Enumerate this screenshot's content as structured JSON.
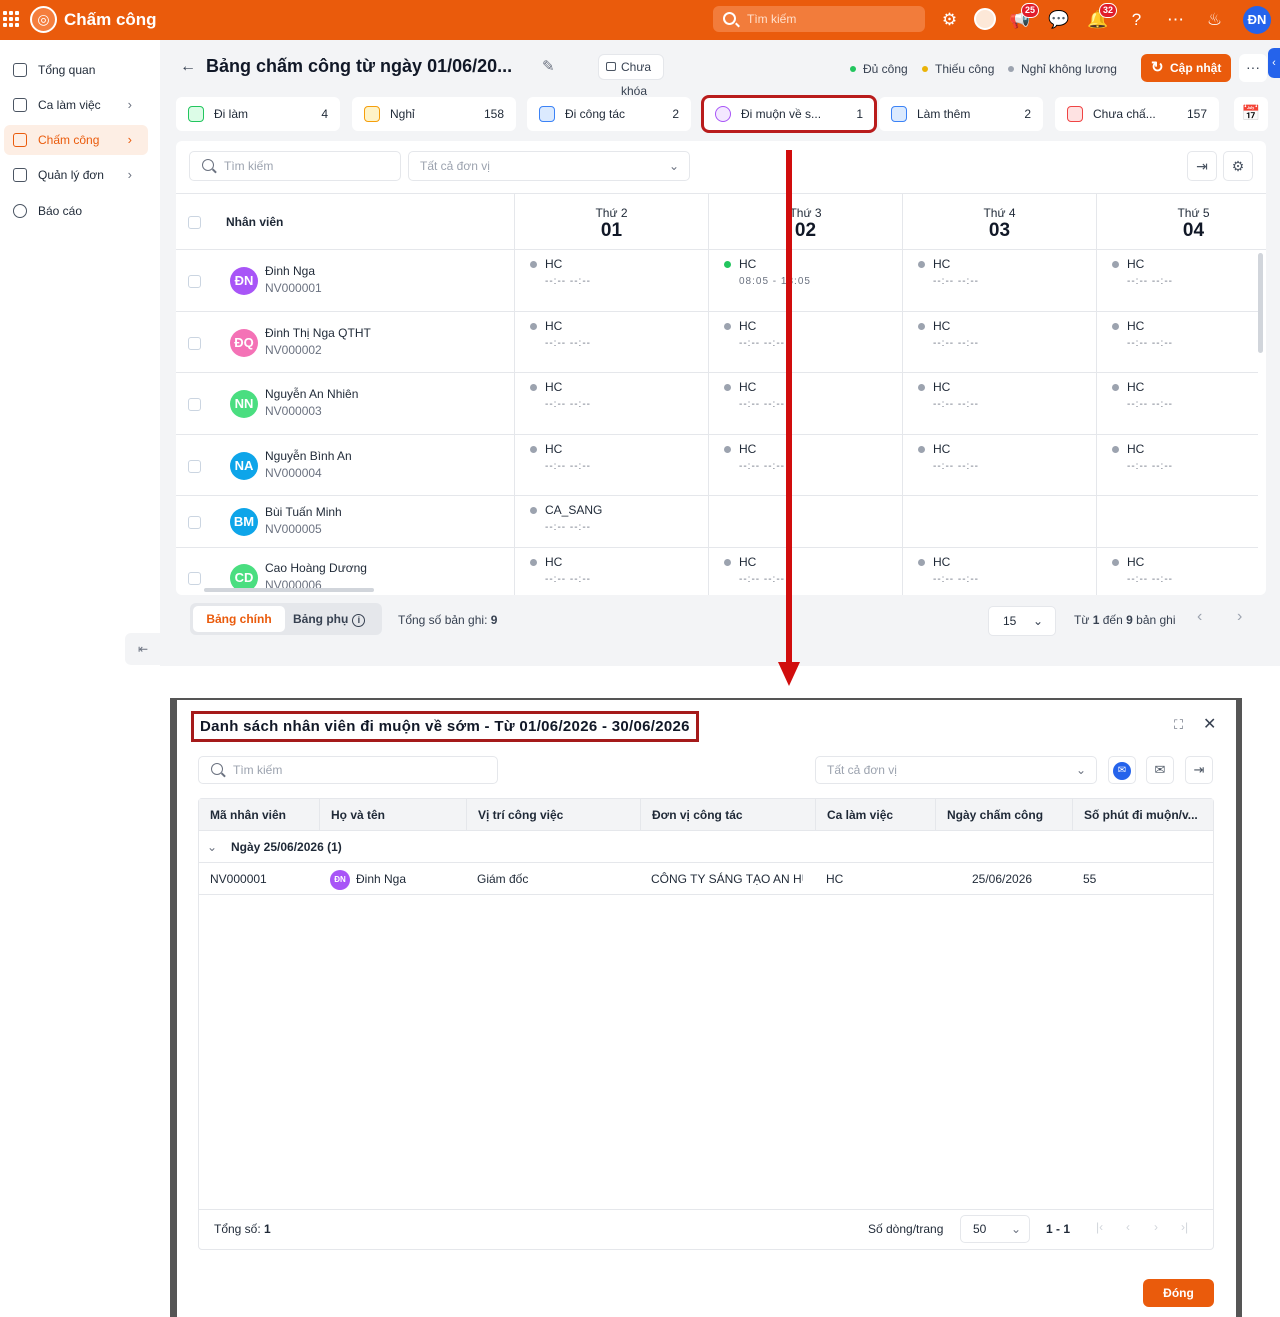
{
  "topbar": {
    "app_title": "Chấm công",
    "search_placeholder": "Tìm kiếm",
    "announce_badge": "25",
    "notify_badge": "32",
    "user_initials": "ĐN",
    "brand_color": "#ea5b0c"
  },
  "sidebar": {
    "items": [
      {
        "label": "Tổng quan",
        "icon": "home-icon"
      },
      {
        "label": "Ca làm việc",
        "icon": "calendar-icon"
      },
      {
        "label": "Chấm công",
        "icon": "checklist-icon"
      },
      {
        "label": "Quản lý đơn",
        "icon": "document-icon"
      },
      {
        "label": "Báo cáo",
        "icon": "pie-chart-icon"
      }
    ]
  },
  "page": {
    "title": "Bảng chấm công từ ngày 01/06/20...",
    "lock_status": "Chưa khóa",
    "legend": [
      {
        "label": "Đủ công",
        "color": "#22c55e"
      },
      {
        "label": "Thiếu công",
        "color": "#eab308"
      },
      {
        "label": "Nghỉ không lương",
        "color": "#9ca3af"
      }
    ],
    "update_button": "Cập nhật",
    "more_button": "···"
  },
  "stats": [
    {
      "label": "Đi làm",
      "value": "4",
      "color": "#22c55e"
    },
    {
      "label": "Nghỉ",
      "value": "158",
      "color": "#f59e0b"
    },
    {
      "label": "Đi công tác",
      "value": "2",
      "color": "#3b82f6"
    },
    {
      "label": "Đi muộn về s...",
      "value": "1",
      "color": "#a855f7"
    },
    {
      "label": "Làm thêm",
      "value": "2",
      "color": "#3b82f6"
    },
    {
      "label": "Chưa chấ...",
      "value": "157",
      "color": "#ef4444"
    }
  ],
  "table": {
    "search_placeholder": "Tìm kiếm",
    "unit_placeholder": "Tất cả đơn vị",
    "employee_header": "Nhân viên",
    "days": [
      {
        "weekday": "Thứ 2",
        "date": "01"
      },
      {
        "weekday": "Thứ 3",
        "date": "02"
      },
      {
        "weekday": "Thứ 4",
        "date": "03"
      },
      {
        "weekday": "Thứ 5",
        "date": "04"
      }
    ],
    "rows": [
      {
        "initials": "ĐN",
        "name": "Đinh Nga",
        "code": "NV000001",
        "color": "#a855f7",
        "cells": [
          {
            "shift": "HC",
            "time": "--:-- --:--"
          },
          {
            "shift": "HC",
            "time": "08:05 - 18:05"
          },
          {
            "shift": "HC",
            "time": "--:-- --:--"
          },
          {
            "shift": "HC",
            "time": "--:-- --:--"
          }
        ]
      },
      {
        "initials": "ĐQ",
        "name": "Đinh Thị Nga QTHT",
        "code": "NV000002",
        "color": "#f472b6",
        "cells": [
          {
            "shift": "HC",
            "time": "--:-- --:--"
          },
          {
            "shift": "HC",
            "time": "--:-- --:--"
          },
          {
            "shift": "HC",
            "time": "--:-- --:--"
          },
          {
            "shift": "HC",
            "time": "--:-- --:--"
          }
        ]
      },
      {
        "initials": "NN",
        "name": "Nguyễn An Nhiên",
        "code": "NV000003",
        "color": "#4ade80",
        "cells": [
          {
            "shift": "HC",
            "time": "--:-- --:--"
          },
          {
            "shift": "HC",
            "time": "--:-- --:--"
          },
          {
            "shift": "HC",
            "time": "--:-- --:--"
          },
          {
            "shift": "HC",
            "time": "--:-- --:--"
          }
        ]
      },
      {
        "initials": "NA",
        "name": "Nguyễn Bình An",
        "code": "NV000004",
        "color": "#0ea5e9",
        "cells": [
          {
            "shift": "HC",
            "time": "--:-- --:--"
          },
          {
            "shift": "HC",
            "time": "--:-- --:--"
          },
          {
            "shift": "HC",
            "time": "--:-- --:--"
          },
          {
            "shift": "HC",
            "time": "--:-- --:--"
          }
        ]
      },
      {
        "initials": "BM",
        "name": "Bùi Tuấn Minh",
        "code": "NV000005",
        "color": "#0ea5e9",
        "cells": [
          {
            "shift": "CA_SANG",
            "time": "--:-- --:--"
          },
          {
            "shift": "",
            "time": ""
          },
          {
            "shift": "",
            "time": ""
          },
          {
            "shift": "",
            "time": ""
          }
        ]
      },
      {
        "initials": "CD",
        "name": "Cao Hoàng Dương",
        "code": "NV000006",
        "color": "#4ade80",
        "cells": [
          {
            "shift": "HC",
            "time": "--:-- --:--"
          },
          {
            "shift": "HC",
            "time": "--:-- --:--"
          },
          {
            "shift": "HC",
            "time": "--:-- --:--"
          },
          {
            "shift": "HC",
            "time": "--:-- --:--"
          }
        ]
      }
    ]
  },
  "footer": {
    "tab_main": "Bảng chính",
    "tab_sub": "Bảng phụ",
    "total_label": "Tổng số bản ghi:",
    "total_value": "9",
    "page_size": "15",
    "range_from_label": "Từ",
    "range_from": "1",
    "range_to_label": "đến",
    "range_to": "9",
    "range_suffix": "bản ghi"
  },
  "modal": {
    "title": "Danh sách nhân viên đi muộn về sớm - Từ 01/06/2026 - 30/06/2026",
    "search_placeholder": "Tìm kiếm",
    "unit_placeholder": "Tất cả đơn vị",
    "columns": [
      "Mã nhân viên",
      "Họ và tên",
      "Vị trí công việc",
      "Đơn vị công tác",
      "Ca làm việc",
      "Ngày chấm công",
      "Số phút đi muộn/v..."
    ],
    "group_label": "Ngày 25/06/2026 (1)",
    "row": {
      "code": "NV000001",
      "initials": "ĐN",
      "name": "Đinh Nga",
      "position": "Giám đốc",
      "unit": "CÔNG TY SÁNG TẠO AN HƯ",
      "shift": "HC",
      "date": "25/06/2026",
      "minutes": "55"
    },
    "total_label": "Tổng số:",
    "total_value": "1",
    "rows_per_page_label": "Số dòng/trang",
    "rows_per_page": "50",
    "range": "1 - 1",
    "close_button": "Đóng"
  }
}
